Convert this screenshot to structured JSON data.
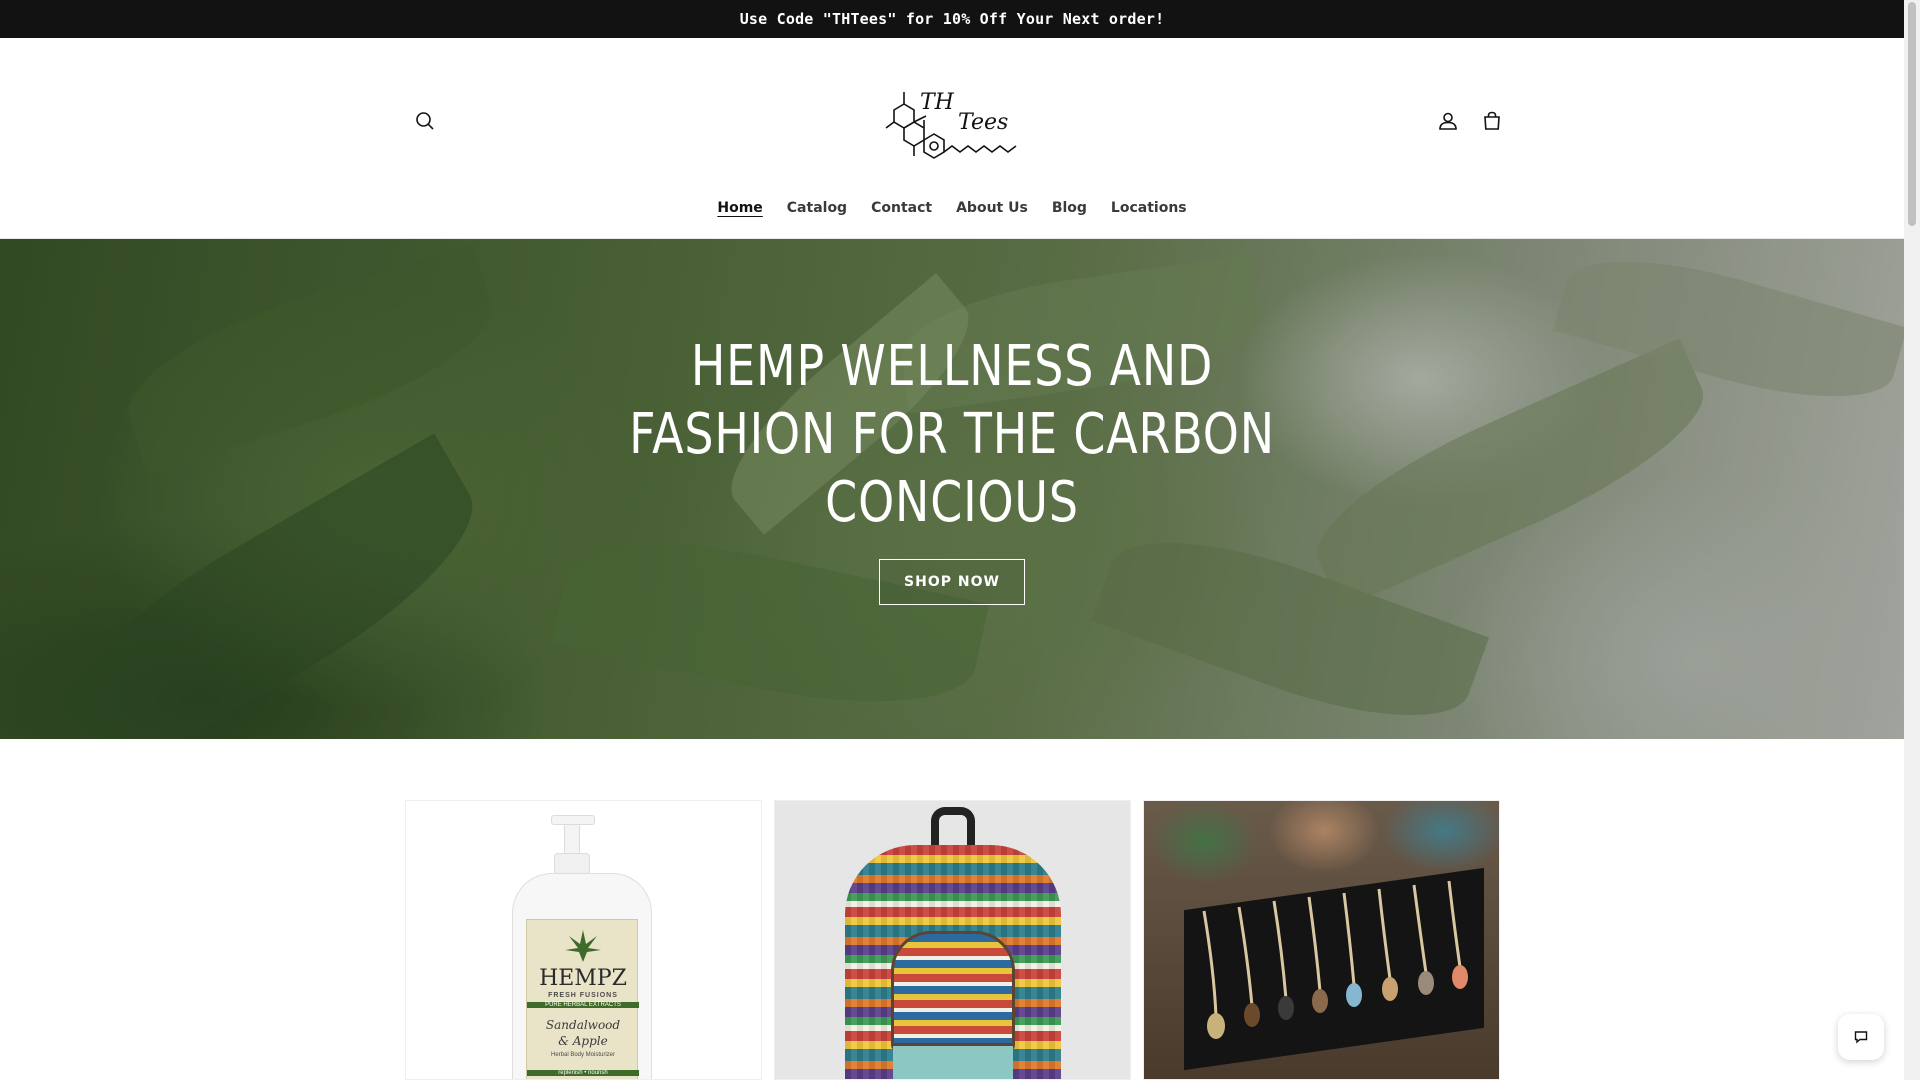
{
  "announcement": {
    "text": "Use Code \"THTees\" for 10% Off Your Next order!"
  },
  "header": {
    "logo_text_1": "TH",
    "logo_text_2": "Tees",
    "icons": {
      "search": "search-icon",
      "account": "user-icon",
      "cart": "bag-icon"
    }
  },
  "nav": {
    "items": [
      {
        "label": "Home",
        "active": true
      },
      {
        "label": "Catalog"
      },
      {
        "label": "Contact"
      },
      {
        "label": "About Us"
      },
      {
        "label": "Blog"
      },
      {
        "label": "Locations"
      }
    ]
  },
  "hero": {
    "title": "HEMP WELLNESS AND FASHION FOR THE CARBON CONCIOUS",
    "button_label": "SHOP NOW"
  },
  "products": [
    {
      "image": "hempz-lotion-bottle",
      "brand": "HEMPZ",
      "line": "FRESH FUSIONS",
      "sub": "PURE HERBAL EXTRACTS",
      "flavor_1": "Sandalwood",
      "flavor_2": "& Apple",
      "desc": "Herbal Body Moisturizer",
      "tag": "replenish • nourish"
    },
    {
      "image": "hemp-backpack"
    },
    {
      "image": "crystal-necklaces"
    }
  ],
  "colors": {
    "announcement_bg": "#121212",
    "text": "#121212",
    "accent": "#ffffff"
  }
}
